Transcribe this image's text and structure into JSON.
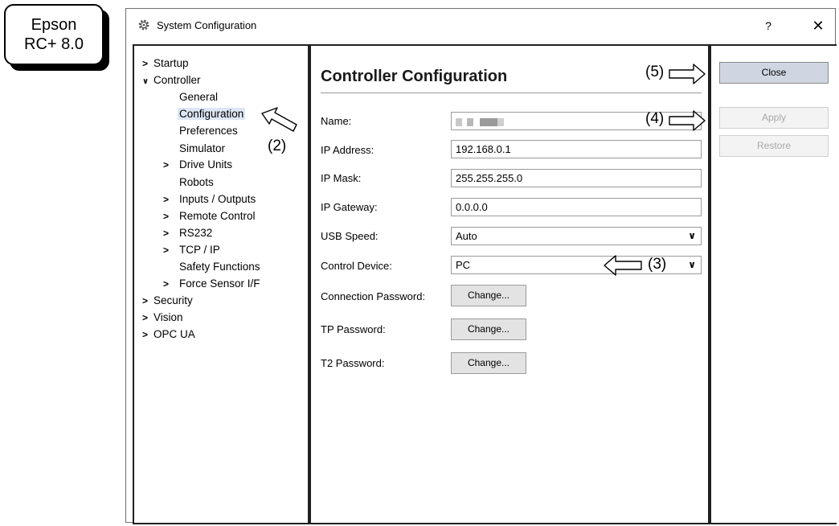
{
  "badge": {
    "line1": "Epson",
    "line2": "RC+ 8.0"
  },
  "window": {
    "title": "System Configuration",
    "help": "?",
    "close": "✕",
    "icon": "gear-icon"
  },
  "tree": {
    "startup": "Startup",
    "controller": "Controller",
    "general": "General",
    "configuration": "Configuration",
    "preferences": "Preferences",
    "simulator": "Simulator",
    "drive_units": "Drive Units",
    "robots": "Robots",
    "inputs_outputs": "Inputs / Outputs",
    "remote_control": "Remote Control",
    "rs232": "RS232",
    "tcp_ip": "TCP / IP",
    "safety_functions": "Safety Functions",
    "force_sensor": "Force Sensor I/F",
    "security": "Security",
    "vision": "Vision",
    "opc_ua": "OPC UA",
    "chevron_right": "›",
    "chevron_down": "⌄"
  },
  "main": {
    "heading": "Controller Configuration",
    "name_label": "Name:",
    "ip_address_label": "IP Address:",
    "ip_address_value": "192.168.0.1",
    "ip_mask_label": "IP Mask:",
    "ip_mask_value": "255.255.255.0",
    "ip_gateway_label": "IP Gateway:",
    "ip_gateway_value": "0.0.0.0",
    "usb_speed_label": "USB Speed:",
    "usb_speed_value": "Auto",
    "control_device_label": "Control Device:",
    "control_device_value": "PC",
    "connection_password_label": "Connection Password:",
    "tp_password_label": "TP Password:",
    "t2_password_label": "T2 Password:",
    "change_label": "Change..."
  },
  "buttons": {
    "close": "Close",
    "apply": "Apply",
    "restore": "Restore"
  },
  "annotations": {
    "a2": "(2)",
    "a3": "(3)",
    "a4": "(4)",
    "a5": "(5)"
  }
}
